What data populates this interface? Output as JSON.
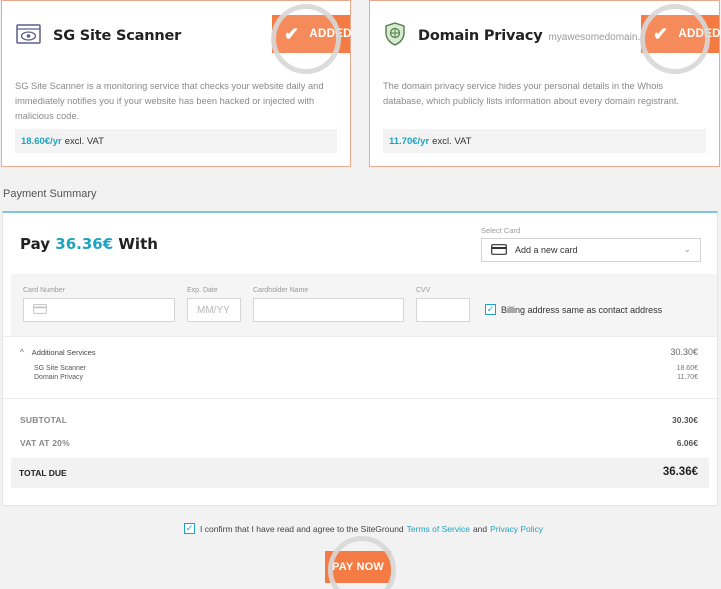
{
  "services": {
    "scanner": {
      "icon": "eye-scanner-icon",
      "title": "SG Site Scanner",
      "status": "ADDED",
      "description": "SG Site Scanner is a monitoring service that checks your website daily and immediately notifies you if your website has been hacked or injected with malicious code.",
      "price": "18.60€/yr",
      "price_suffix": "excl. VAT"
    },
    "privacy": {
      "icon": "shield-icon",
      "title": "Domain Privacy",
      "domain": "myawesomedomain.co",
      "status": "ADDED",
      "description": "The domain privacy service hides your personal details in the Whois database, which publicly lists information about every domain registrant.",
      "price": "11.70€/yr",
      "price_suffix": "excl. VAT"
    }
  },
  "summary": {
    "section_title": "Payment Summary",
    "pay_prefix": "Pay",
    "pay_amount": "36.36€",
    "pay_suffix": "With",
    "select_card_label": "Select Card",
    "select_card_value": "Add a new card"
  },
  "form": {
    "card_number_label": "Card Number",
    "exp_label": "Exp. Date",
    "exp_placeholder": "MM/YY",
    "holder_label": "Cardholder Name",
    "cvv_label": "CVV",
    "billing_same": "Billing address same as contact address",
    "billing_checked": true
  },
  "additional": {
    "label": "Additional Services",
    "total": "30.30€",
    "items": [
      {
        "name": "SG Site Scanner",
        "price": "18.60€"
      },
      {
        "name": "Domain Privacy",
        "price": "11.70€"
      }
    ]
  },
  "totals": {
    "subtotal_label": "SUBTOTAL",
    "subtotal": "30.30€",
    "vat_label": "VAT AT 20%",
    "vat": "6.06€",
    "total_label": "TOTAL DUE",
    "total": "36.36€"
  },
  "footer": {
    "confirm_text": "I confirm that I have read and agree to the SiteGround",
    "terms_link": "Terms of Service",
    "and_text": "and",
    "privacy_link": "Privacy Policy",
    "pay_button": "PAY NOW"
  },
  "colors": {
    "accent_orange": "#f47c44",
    "accent_blue": "#1fa3c1"
  }
}
